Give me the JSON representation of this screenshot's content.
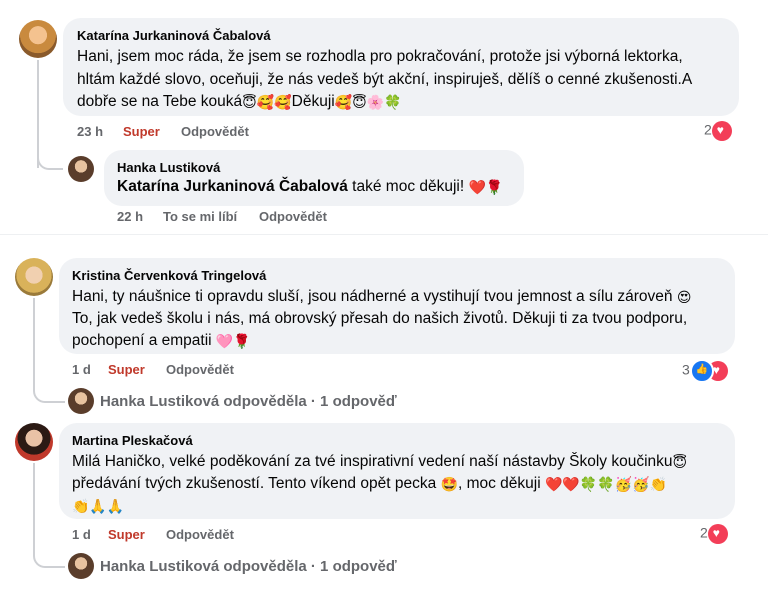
{
  "colors": {
    "bubble": "#f0f2f5",
    "meta": "#65676b",
    "reaction_super": "#c0392b",
    "heart": "#f33e58",
    "like": "#1877f2",
    "thread_line": "#ced0d4"
  },
  "comments": [
    {
      "author": "Katarína Jurkaninová Čabalová",
      "lines": [
        "Hani, jsem moc ráda, že jsem se rozhodla pro pokračování, protože jsi výborná lektorka,",
        "hltám každé slovo, oceňuji, že nás vedeš být akční, inspiruješ, dělíš o cenné zkušenosti.A",
        "dobře se na Tebe kouká"
      ],
      "line3_tail": "Děkuji",
      "time": "23 h",
      "reaction_label": "Super",
      "reply_label": "Odpovědět",
      "reaction_count": "2",
      "reply": {
        "author": "Hanka Lustiková",
        "mention": "Katarína Jurkaninová Čabalová",
        "text": " také moc děkuji! ",
        "time": "22 h",
        "like_label": "To se mi líbí",
        "reply_label": "Odpovědět"
      }
    },
    {
      "author": "Kristina Červenková Tringelová",
      "lines": [
        "Hani, ty náušnice ti opravdu sluší, jsou nádherné a vystihují tvou jemnost a sílu zároveň",
        "To, jak vedeš školu i nás, má obrovský přesah do našich životů. Děkuji ti za tvou podporu,",
        "pochopení a empatii"
      ],
      "time": "1 d",
      "reaction_label": "Super",
      "reply_label": "Odpovědět",
      "reaction_count": "3",
      "replies_summary": "Hanka Lustiková odpověděla · 1 odpověď"
    },
    {
      "author": "Martina Pleskačová",
      "lines": [
        "Milá Haničko, velké poděkování za tvé inspirativní vedení naší nástavby Školy koučinku",
        "předávání tvých zkušeností. Tento víkend opět pecka",
        ", moc děkuji"
      ],
      "time": "1 d",
      "reaction_label": "Super",
      "reply_label": "Odpovědět",
      "reaction_count": "2",
      "replies_summary": "Hanka Lustiková odpověděla · 1 odpověď"
    }
  ]
}
